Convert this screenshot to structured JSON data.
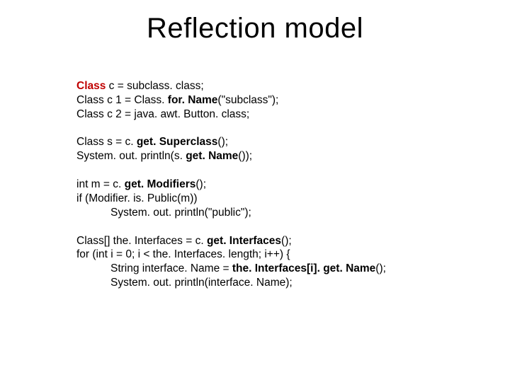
{
  "title": "Reflection model",
  "block1": {
    "l1_type": "Class",
    "l1_rest": " c = subclass. class;",
    "l2_pre": "Class c 1 = Class. ",
    "l2_bold": "for. Name",
    "l2_post": "(\"subclass\");",
    "l3": "Class c 2 = java. awt. Button. class;"
  },
  "block2": {
    "l1_pre": "Class s = c. ",
    "l1_bold": "get. Superclass",
    "l1_post": "();",
    "l2_pre": "System. out. println(s. ",
    "l2_bold": "get. Name",
    "l2_post": "());"
  },
  "block3": {
    "l1_pre": "int m = c. ",
    "l1_bold": "get. Modifiers",
    "l1_post": "();",
    "l2": "if (Modifier. is. Public(m))",
    "l3": "System. out. println(\"public\");"
  },
  "block4": {
    "l1_pre": "Class[] the. Interfaces = c. ",
    "l1_bold": "get. Interfaces",
    "l1_post": "();",
    "l2": "for (int i = 0; i < the. Interfaces. length; i++) {",
    "l3_pre": "String interface. Name = ",
    "l3_bold": "the. Interfaces[i]. get. Name",
    "l3_post": "();",
    "l4": "System. out. println(interface. Name);"
  }
}
